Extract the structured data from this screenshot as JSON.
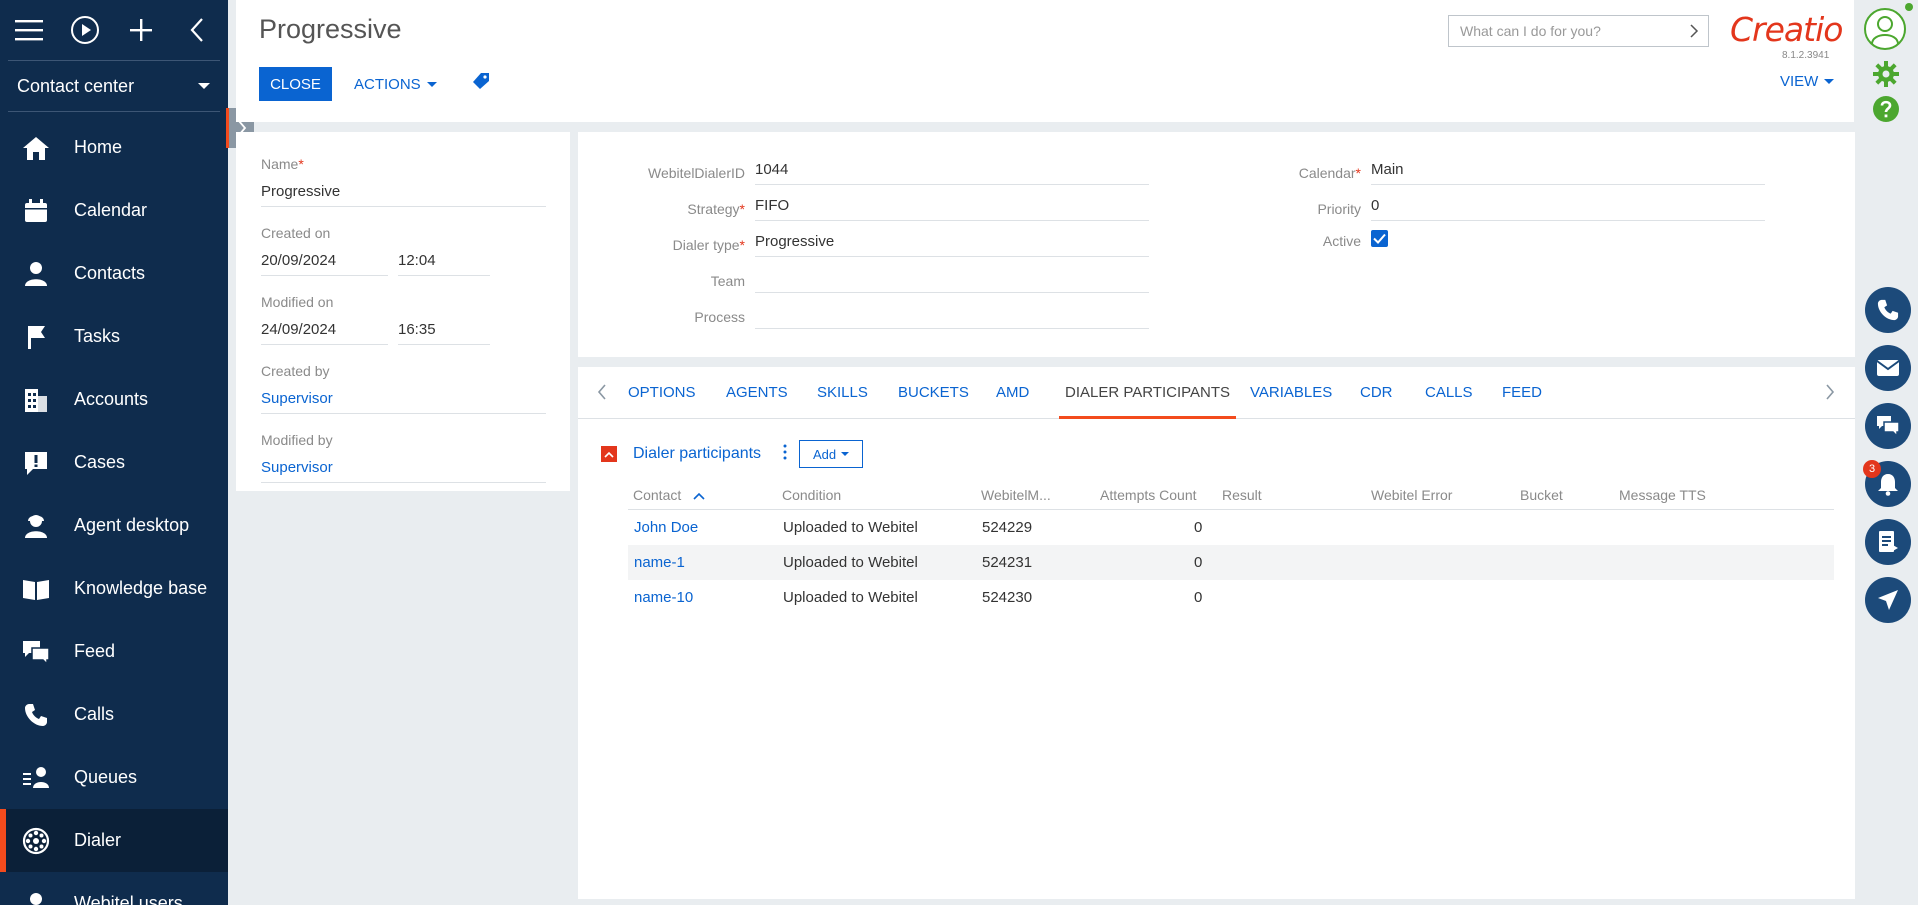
{
  "sidebar": {
    "workplace": "Contact center",
    "items": [
      {
        "label": "Home"
      },
      {
        "label": "Calendar"
      },
      {
        "label": "Contacts"
      },
      {
        "label": "Tasks"
      },
      {
        "label": "Accounts"
      },
      {
        "label": "Cases"
      },
      {
        "label": "Agent desktop"
      },
      {
        "label": "Knowledge base"
      },
      {
        "label": "Feed"
      },
      {
        "label": "Calls"
      },
      {
        "label": "Queues"
      },
      {
        "label": "Dialer"
      },
      {
        "label": "Webitel users"
      }
    ],
    "active_item": "Dialer"
  },
  "header": {
    "title": "Progressive",
    "close_label": "CLOSE",
    "actions_label": "ACTIONS",
    "view_label": "VIEW",
    "search_placeholder": "What can I do for you?",
    "logo_text": "Creatio",
    "version": "8.1.2.3941"
  },
  "profile": {
    "name_label": "Name",
    "name_value": "Progressive",
    "created_on_label": "Created on",
    "created_on_date": "20/09/2024",
    "created_on_time": "12:04",
    "modified_on_label": "Modified on",
    "modified_on_date": "24/09/2024",
    "modified_on_time": "16:35",
    "created_by_label": "Created by",
    "created_by_value": "Supervisor",
    "modified_by_label": "Modified by",
    "modified_by_value": "Supervisor"
  },
  "details": {
    "webitel_dialer_id_label": "WebitelDialerID",
    "webitel_dialer_id_value": "1044",
    "strategy_label": "Strategy",
    "strategy_value": "FIFO",
    "dialer_type_label": "Dialer type",
    "dialer_type_value": "Progressive",
    "team_label": "Team",
    "team_value": "",
    "process_label": "Process",
    "process_value": "",
    "calendar_label": "Calendar",
    "calendar_value": "Main",
    "priority_label": "Priority",
    "priority_value": "0",
    "active_label": "Active",
    "active_checked": true
  },
  "tabs": [
    "OPTIONS",
    "AGENTS",
    "SKILLS",
    "BUCKETS",
    "AMD",
    "DIALER PARTICIPANTS",
    "VARIABLES",
    "CDR",
    "CALLS",
    "FEED"
  ],
  "active_tab": "DIALER PARTICIPANTS",
  "participants": {
    "title": "Dialer participants",
    "add_label": "Add",
    "columns": [
      "Contact",
      "Condition",
      "WebitelM...",
      "Attempts Count",
      "Result",
      "Webitel Error",
      "Bucket",
      "Message TTS"
    ],
    "rows": [
      {
        "contact": "John Doe",
        "condition": "Uploaded to Webitel",
        "webitel_m": "524229",
        "attempts": "0"
      },
      {
        "contact": "name-1",
        "condition": "Uploaded to Webitel",
        "webitel_m": "524231",
        "attempts": "0"
      },
      {
        "contact": "name-10",
        "condition": "Uploaded to Webitel",
        "webitel_m": "524230",
        "attempts": "0"
      }
    ]
  },
  "right_rail": {
    "notification_count": "3"
  },
  "colors": {
    "sidebar_bg": "#0f2c4d",
    "accent": "#0a64d1",
    "brand": "#e3361c",
    "active_marker": "#f34b1d"
  }
}
